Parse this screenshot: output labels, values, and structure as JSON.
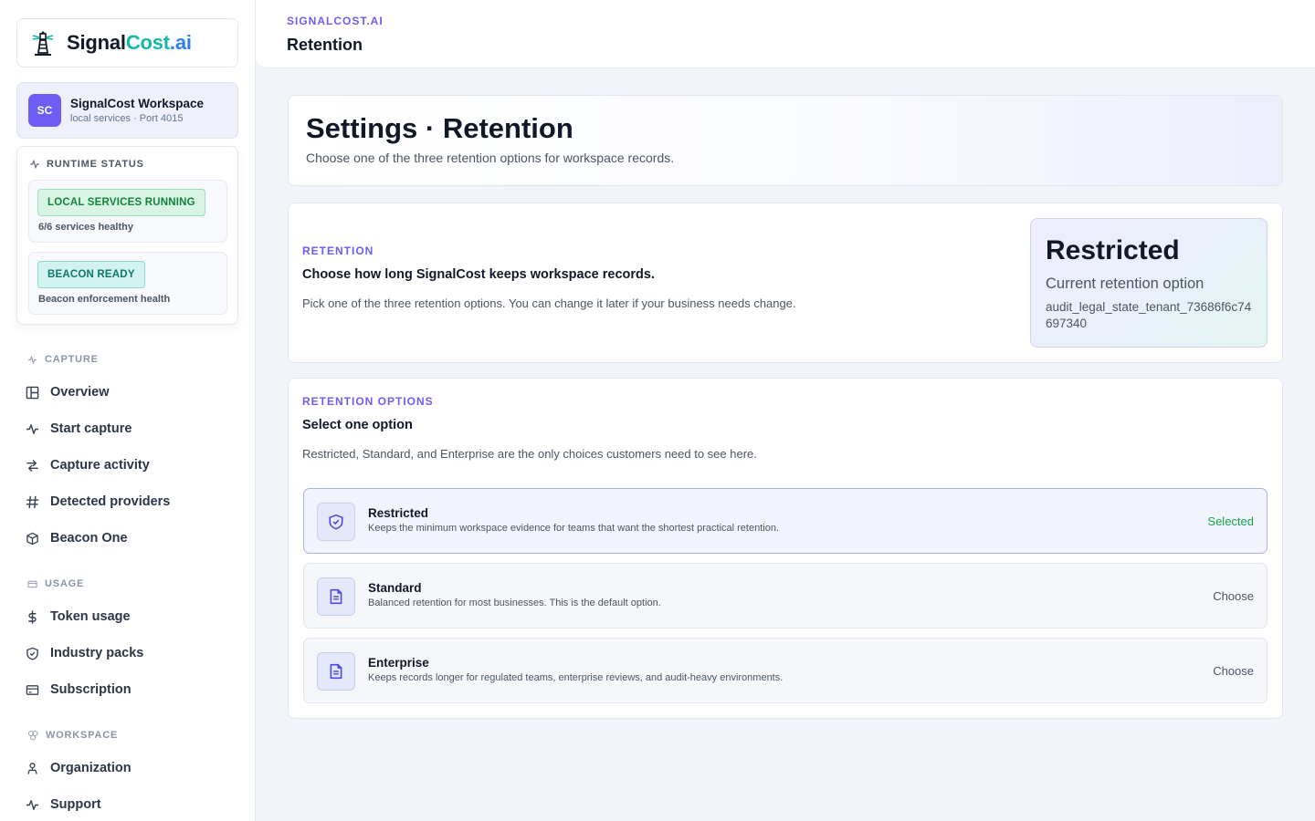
{
  "brand": {
    "name_part1": "Signal",
    "name_part2": "Cost",
    "name_part3": ".ai",
    "logo_icon": "lighthouse-icon"
  },
  "workspace": {
    "avatar": "SC",
    "name": "SignalCost Workspace",
    "subtitle": "local services · Port 4015"
  },
  "runtime": {
    "heading": "RUNTIME STATUS",
    "cards": [
      {
        "badge": "LOCAL SERVICES RUNNING",
        "text": "6/6 services healthy",
        "color": "#15803d"
      },
      {
        "badge": "BEACON READY",
        "text": "Beacon enforcement health",
        "color": "#0f766e"
      }
    ]
  },
  "nav": {
    "capture": {
      "label": "CAPTURE",
      "items": [
        {
          "label": "Overview",
          "icon": "layout-icon"
        },
        {
          "label": "Start capture",
          "icon": "activity-icon"
        },
        {
          "label": "Capture activity",
          "icon": "arrows-icon"
        },
        {
          "label": "Detected providers",
          "icon": "hash-icon"
        },
        {
          "label": "Beacon One",
          "icon": "box-icon"
        }
      ]
    },
    "usage": {
      "label": "USAGE",
      "items": [
        {
          "label": "Token usage",
          "icon": "dollar-icon"
        },
        {
          "label": "Industry packs",
          "icon": "shield-icon"
        },
        {
          "label": "Subscription",
          "icon": "card-icon"
        }
      ]
    },
    "workspace": {
      "label": "WORKSPACE",
      "items": [
        {
          "label": "Organization",
          "icon": "org-icon"
        },
        {
          "label": "Support",
          "icon": "activity-icon"
        }
      ]
    }
  },
  "topbar": {
    "breadcrumb": "SIGNALCOST.AI",
    "title": "Retention"
  },
  "hero": {
    "title": "Settings · Retention",
    "subtitle": "Choose one of the three retention options for workspace records."
  },
  "retention": {
    "eyebrow": "RETENTION",
    "heading": "Choose how long SignalCost keeps workspace records.",
    "description": "Pick one of the three retention options. You can change it later if your business needs change.",
    "current": {
      "value": "Restricted",
      "label": "Current retention option",
      "id": "audit_legal_state_tenant_73686f6c74697340"
    }
  },
  "options": {
    "eyebrow": "RETENTION OPTIONS",
    "heading": "Select one option",
    "description": "Restricted, Standard, and Enterprise are the only choices customers need to see here.",
    "items": [
      {
        "title": "Restricted",
        "desc": "Keeps the minimum workspace evidence for teams that want the shortest practical retention.",
        "action": "Selected",
        "selected": true,
        "icon": "shield-check-icon"
      },
      {
        "title": "Standard",
        "desc": "Balanced retention for most businesses. This is the default option.",
        "action": "Choose",
        "selected": false,
        "icon": "document-icon"
      },
      {
        "title": "Enterprise",
        "desc": "Keeps records longer for regulated teams, enterprise reviews, and audit-heavy environments.",
        "action": "Choose",
        "selected": false,
        "icon": "document-icon"
      }
    ]
  },
  "colors": {
    "accent": "#6d5df5",
    "brand_teal": "#14b8a6",
    "brand_blue": "#2f80ed",
    "selected": "#16a34a"
  }
}
